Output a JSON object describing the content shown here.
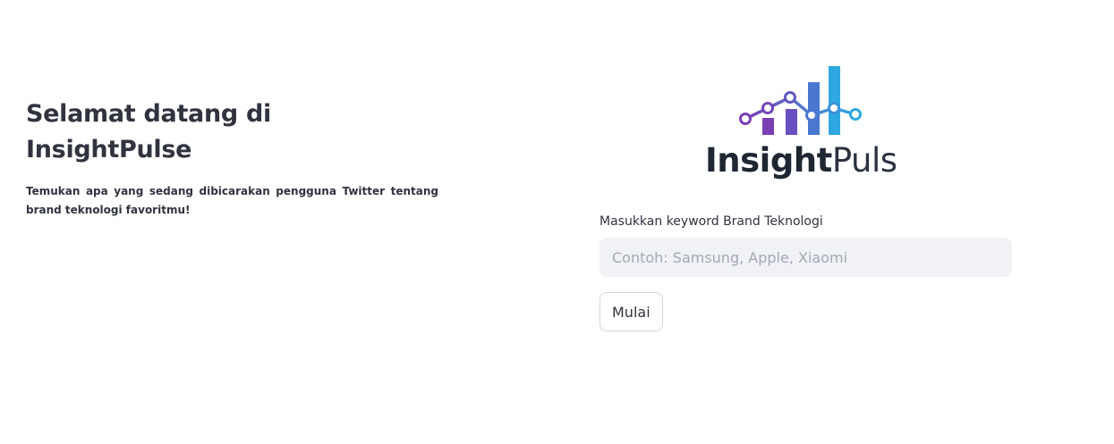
{
  "header": {
    "title": "Selamat datang di InsightPulse",
    "description": "Temukan apa yang sedang dibicarakan pengguna Twitter tentang brand teknologi favoritmu!"
  },
  "logo": {
    "text_dark": "Insight",
    "text_light": "Pulse",
    "colors": {
      "purple": "#7b3fb4",
      "blue": "#2fa8df",
      "dark_text": "#1f2733",
      "light_text": "#2a3240"
    }
  },
  "form": {
    "label": "Masukkan keyword Brand Teknologi",
    "input_value": "",
    "input_placeholder": "Contoh: Samsung, Apple, Xiaomi",
    "submit_label": "Mulai"
  },
  "theme": {
    "text_color": "#31333f",
    "input_background": "#f0f2f6",
    "button_border": "#d6d6d9"
  }
}
